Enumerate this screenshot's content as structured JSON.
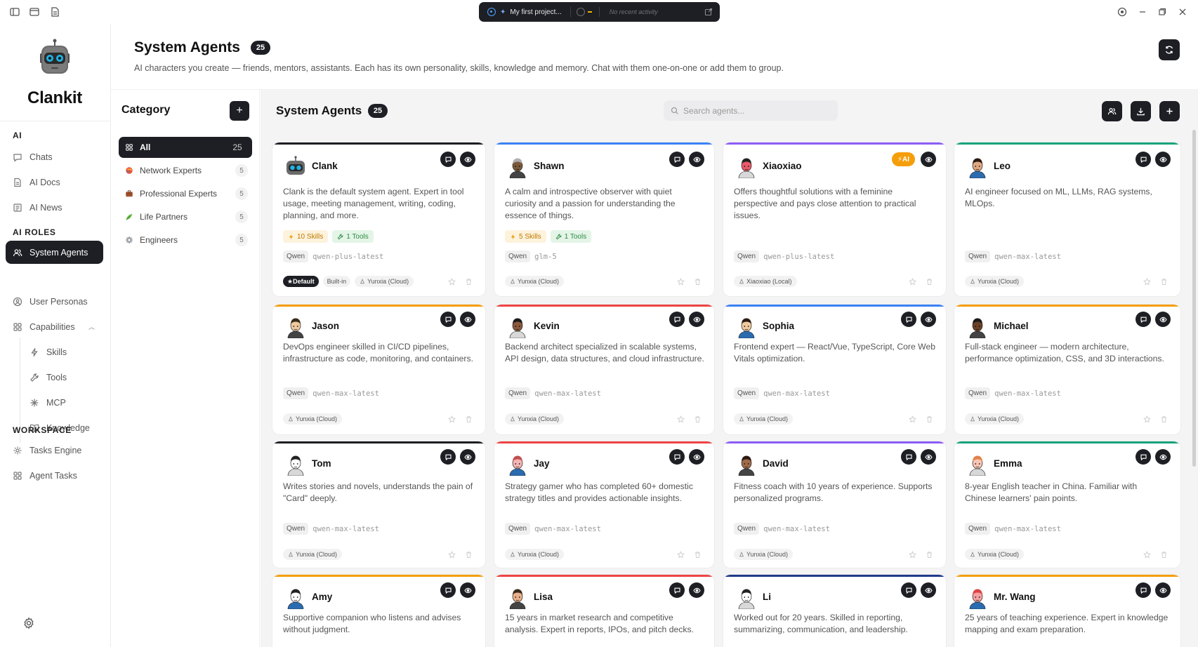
{
  "window": {
    "project_name": "My first project...",
    "recent_activity": "No recent activity"
  },
  "app": {
    "name": "Clankit"
  },
  "sidebar": {
    "sections": [
      {
        "title": "AI"
      },
      {
        "title": "AI ROLES"
      },
      {
        "title": "WORKSPACE"
      }
    ],
    "items": [
      {
        "label": "Chats",
        "icon": "chat-icon"
      },
      {
        "label": "AI Docs",
        "icon": "document-icon"
      },
      {
        "label": "AI News",
        "icon": "news-icon"
      },
      {
        "label": "System Agents",
        "icon": "users-icon",
        "active": true
      },
      {
        "label": "User Personas",
        "icon": "persona-icon"
      },
      {
        "label": "Capabilities",
        "icon": "grid-icon"
      },
      {
        "label": "Skills",
        "icon": "bolt-icon"
      },
      {
        "label": "Tools",
        "icon": "wrench-icon"
      },
      {
        "label": "MCP",
        "icon": "mcp-icon"
      },
      {
        "label": "Knowledge",
        "icon": "book-icon"
      },
      {
        "label": "Tasks Engine",
        "icon": "gear-icon"
      },
      {
        "label": "Agent Tasks",
        "icon": "grid-icon"
      }
    ]
  },
  "header": {
    "title": "System Agents",
    "count": "25",
    "description": "AI characters you create — friends, mentors, assistants. Each has its own personality, skills, knowledge and memory. Chat with them one-on-one or add them to group."
  },
  "categories": {
    "title": "Category",
    "items": [
      {
        "label": "All",
        "count": "25",
        "active": true
      },
      {
        "label": "Network Experts",
        "count": "5"
      },
      {
        "label": "Professional Experts",
        "count": "5"
      },
      {
        "label": "Life Partners",
        "count": "5"
      },
      {
        "label": "Engineers",
        "count": "5"
      }
    ]
  },
  "agents_panel": {
    "title": "System Agents",
    "count": "25",
    "search_placeholder": "Search agents..."
  },
  "agents": [
    {
      "name": "Clank",
      "accent": "#1d1f24",
      "description": "Clank is the default system agent. Expert in tool usage, meeting management, writing, coding, planning, and more.",
      "skills": "10 Skills",
      "tools": "1 Tools",
      "provider": "Qwen",
      "model": "qwen-plus-latest",
      "default_label": "Default",
      "builtin_label": "Built-in",
      "runtime": "Yunxia (Cloud)"
    },
    {
      "name": "Shawn",
      "accent": "#3b82f6",
      "description": "A calm and introspective observer with quiet curiosity and a passion for understanding the essence of things.",
      "skills": "5 Skills",
      "tools": "1 Tools",
      "provider": "Qwen",
      "model": "glm-5",
      "runtime": "Yunxia (Cloud)"
    },
    {
      "name": "Xiaoxiao",
      "accent": "#8b5cf6",
      "ai_badge": "AI",
      "description": "Offers thoughtful solutions with a feminine perspective and pays close attention to practical issues.",
      "provider": "Qwen",
      "model": "qwen-plus-latest",
      "runtime": "Xiaoxiao (Local)"
    },
    {
      "name": "Leo",
      "accent": "#16a37a",
      "description": "AI engineer focused on ML, LLMs, RAG systems, MLOps.",
      "provider": "Qwen",
      "model": "qwen-max-latest",
      "runtime": "Yunxia (Cloud)"
    },
    {
      "name": "Jason",
      "accent": "#f59e0b",
      "description": "DevOps engineer skilled in CI/CD pipelines, infrastructure as code, monitoring, and containers.",
      "provider": "Qwen",
      "model": "qwen-max-latest",
      "runtime": "Yunxia (Cloud)"
    },
    {
      "name": "Kevin",
      "accent": "#ef4444",
      "description": "Backend architect specialized in scalable systems, API design, data structures, and cloud infrastructure.",
      "provider": "Qwen",
      "model": "qwen-max-latest",
      "runtime": "Yunxia (Cloud)"
    },
    {
      "name": "Sophia",
      "accent": "#3b82f6",
      "description": "Frontend expert — React/Vue, TypeScript, Core Web Vitals optimization.",
      "provider": "Qwen",
      "model": "qwen-max-latest",
      "runtime": "Yunxia (Cloud)"
    },
    {
      "name": "Michael",
      "accent": "#f59e0b",
      "description": "Full-stack engineer — modern architecture, performance optimization, CSS, and 3D interactions.",
      "provider": "Qwen",
      "model": "qwen-max-latest",
      "runtime": "Yunxia (Cloud)"
    },
    {
      "name": "Tom",
      "accent": "#1d1f24",
      "description": "Writes stories and novels, understands the pain of \"Card\" deeply.",
      "provider": "Qwen",
      "model": "qwen-max-latest",
      "runtime": "Yunxia (Cloud)"
    },
    {
      "name": "Jay",
      "accent": "#ef4444",
      "description": "Strategy gamer who has completed 60+ domestic strategy titles and provides actionable insights.",
      "provider": "Qwen",
      "model": "qwen-max-latest",
      "runtime": "Yunxia (Cloud)"
    },
    {
      "name": "David",
      "accent": "#8b5cf6",
      "description": "Fitness coach with 10 years of experience. Supports personalized programs.",
      "provider": "Qwen",
      "model": "qwen-max-latest",
      "runtime": "Yunxia (Cloud)"
    },
    {
      "name": "Emma",
      "accent": "#16a37a",
      "description": "8-year English teacher in China. Familiar with Chinese learners' pain points.",
      "provider": "Qwen",
      "model": "qwen-max-latest",
      "runtime": "Yunxia (Cloud)"
    },
    {
      "name": "Amy",
      "accent": "#f59e0b",
      "description": "Supportive companion who listens and advises without judgment."
    },
    {
      "name": "Lisa",
      "accent": "#ef4444",
      "description": "15 years in market research and competitive analysis. Expert in reports, IPOs, and pitch decks."
    },
    {
      "name": "Li",
      "accent": "#1e3a8a",
      "description": "Worked out for 20 years. Skilled in reporting, summarizing, communication, and leadership."
    },
    {
      "name": "Mr. Wang",
      "accent": "#f59e0b",
      "description": "25 years of teaching experience. Expert in knowledge mapping and exam preparation."
    }
  ],
  "colors": {
    "accent_dark": "#1d1f24",
    "panel_bg": "#f4f4f5",
    "skill_tag": "#c17800",
    "tool_tag": "#2d8a45",
    "ai_badge": "#f59e0b"
  }
}
